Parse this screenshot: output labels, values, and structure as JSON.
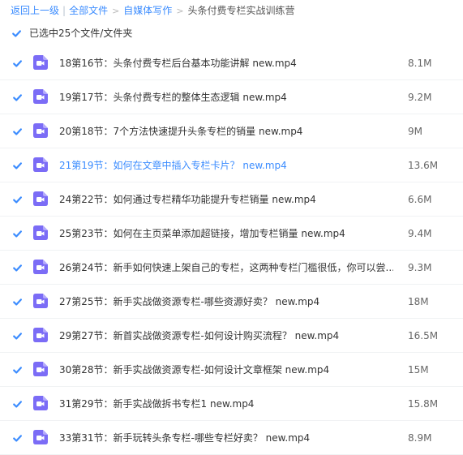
{
  "breadcrumb": {
    "back": "返回上一级",
    "all_files": "全部文件",
    "folder1": "自媒体写作",
    "current": "头条付费专栏实战训练营"
  },
  "selection": {
    "label": "已选中25个文件/文件夹"
  },
  "colors": {
    "accent": "#3b8cff",
    "checkbox": "#3b8cff",
    "video_icon": "#7b6cf6"
  },
  "files": [
    {
      "name": "18第16节：头条付费专栏后台基本功能讲解 new.mp4",
      "size": "8.1M",
      "icon": "video-file-icon",
      "highlight": false
    },
    {
      "name": "19第17节：头条付费专栏的整体生态逻辑 new.mp4",
      "size": "9.2M",
      "icon": "video-file-icon",
      "highlight": false
    },
    {
      "name": "20第18节：7个方法快速提升头条专栏的销量 new.mp4",
      "size": "9M",
      "icon": "video-file-icon",
      "highlight": false
    },
    {
      "name": "21第19节：如何在文章中插入专栏卡片？ new.mp4",
      "size": "13.6M",
      "icon": "video-file-icon",
      "highlight": true
    },
    {
      "name": "24第22节：如何通过专栏精华功能提升专栏销量 new.mp4",
      "size": "6.6M",
      "icon": "video-file-icon",
      "highlight": false
    },
    {
      "name": "25第23节：如何在主页菜单添加超链接，增加专栏销量 new.mp4",
      "size": "9.4M",
      "icon": "video-file-icon",
      "highlight": false
    },
    {
      "name": "26第24节：新手如何快速上架自己的专栏，这两种专栏门槛很低，你可以尝...",
      "size": "9.3M",
      "icon": "video-file-icon",
      "highlight": false
    },
    {
      "name": "27第25节：新手实战做资源专栏-哪些资源好卖？ new.mp4",
      "size": "18M",
      "icon": "video-file-icon",
      "highlight": false
    },
    {
      "name": "29第27节：新首实战做资源专栏-如何设计购买流程？ new.mp4",
      "size": "16.5M",
      "icon": "video-file-icon",
      "highlight": false
    },
    {
      "name": "30第28节：新手实战做资源专栏-如何设计文章框架 new.mp4",
      "size": "15M",
      "icon": "video-file-icon",
      "highlight": false
    },
    {
      "name": "31第29节：新手实战做拆书专栏1 new.mp4",
      "size": "15.8M",
      "icon": "video-file-icon",
      "highlight": false
    },
    {
      "name": "33第31节：新手玩转头条专栏-哪些专栏好卖？ new.mp4",
      "size": "8.9M",
      "icon": "video-file-icon",
      "highlight": false
    }
  ]
}
